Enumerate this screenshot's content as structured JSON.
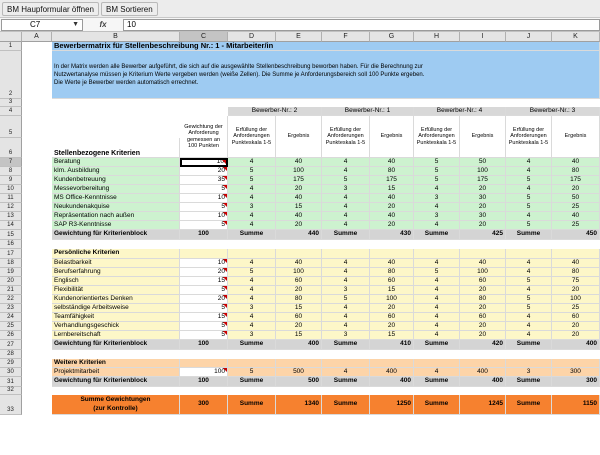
{
  "toolbar": {
    "buttons": [
      "BM Haupformular öffnen",
      "BM Sortieren"
    ]
  },
  "formula_bar": {
    "name_box": "C7",
    "fx_label": "fx",
    "value": "10"
  },
  "columns": [
    "A",
    "B",
    "C",
    "D",
    "E",
    "F",
    "G",
    "H",
    "I",
    "J",
    "K"
  ],
  "selected_cell": "C7",
  "title": "Bewerbermatrix für Stellenbeschreibung Nr.: 1 - Mitarbeiter/in",
  "intro": [
    "In der Matrix werden alle Bewerber aufgeführt, die sich auf die ausgewählte Stellenbeschreibung beworben haben. Für die Berechnung zur",
    "Nutzwertanalyse müssen je Kriterium Werte vergeben werden (weiße Zellen). Die Summe je Anforderungsbereich soll 100 Punkte ergeben.",
    "Die Werte je Bewerber werden automatisch errechnet."
  ],
  "headers": {
    "bewerber": [
      "Bewerber-Nr.: 2",
      "Bewerber-Nr.: 1",
      "Bewerber-Nr.: 4",
      "Bewerber-Nr.: 3"
    ],
    "gewichtung": "Gewichtung der Anforderung gemessen an 100 Punkten",
    "erfuellung": "Erfüllung der Anforderungen Punkteskala 1-5",
    "ergebnis": "Ergebnis",
    "section1": "Stellenbezogene Kriterien"
  },
  "section1": {
    "rows": [
      {
        "label": "Beratung",
        "w": "10",
        "v": [
          "4",
          "40",
          "4",
          "40",
          "5",
          "50",
          "4",
          "40"
        ]
      },
      {
        "label": "klm. Ausbildung",
        "w": "20",
        "v": [
          "5",
          "100",
          "4",
          "80",
          "5",
          "100",
          "4",
          "80"
        ]
      },
      {
        "label": "Kundenbetreuung",
        "w": "35",
        "v": [
          "5",
          "175",
          "5",
          "175",
          "5",
          "175",
          "5",
          "175"
        ]
      },
      {
        "label": "Messevorbereitung",
        "w": "5",
        "v": [
          "4",
          "20",
          "3",
          "15",
          "4",
          "20",
          "4",
          "20"
        ]
      },
      {
        "label": "MS Office-Kenntnisse",
        "w": "10",
        "v": [
          "4",
          "40",
          "4",
          "40",
          "3",
          "30",
          "5",
          "50"
        ]
      },
      {
        "label": "Neukundenakquise",
        "w": "5",
        "v": [
          "3",
          "15",
          "4",
          "20",
          "4",
          "20",
          "5",
          "25"
        ]
      },
      {
        "label": "Repräsentation nach außen",
        "w": "10",
        "v": [
          "4",
          "40",
          "4",
          "40",
          "3",
          "30",
          "4",
          "40"
        ]
      },
      {
        "label": "SAP R3-Kenntnisse",
        "w": "5",
        "v": [
          "4",
          "20",
          "4",
          "20",
          "4",
          "20",
          "5",
          "25"
        ]
      }
    ],
    "total": {
      "label": "Gewichtung für Kriterienblock",
      "w": "100",
      "sum_label": "Summe",
      "sums": [
        "440",
        "430",
        "425",
        "450"
      ]
    }
  },
  "section2": {
    "title": "Persönliche Kriterien",
    "rows": [
      {
        "label": "Belastbarkeit",
        "w": "10",
        "v": [
          "4",
          "40",
          "4",
          "40",
          "4",
          "40",
          "4",
          "40"
        ]
      },
      {
        "label": "Berufserfahrung",
        "w": "20",
        "v": [
          "5",
          "100",
          "4",
          "80",
          "5",
          "100",
          "4",
          "80"
        ]
      },
      {
        "label": "Englisch",
        "w": "15",
        "v": [
          "4",
          "60",
          "4",
          "60",
          "4",
          "60",
          "5",
          "75"
        ]
      },
      {
        "label": "Flexibilität",
        "w": "5",
        "v": [
          "4",
          "20",
          "3",
          "15",
          "4",
          "20",
          "4",
          "20"
        ]
      },
      {
        "label": "Kundenorientiertes Denken",
        "w": "20",
        "v": [
          "4",
          "80",
          "5",
          "100",
          "4",
          "80",
          "5",
          "100"
        ]
      },
      {
        "label": "selbständige Arbeitsweise",
        "w": "5",
        "v": [
          "3",
          "15",
          "4",
          "20",
          "4",
          "20",
          "5",
          "25"
        ]
      },
      {
        "label": "Teamfähigkeit",
        "w": "15",
        "v": [
          "4",
          "60",
          "4",
          "60",
          "4",
          "60",
          "4",
          "60"
        ]
      },
      {
        "label": "Verhandlungsgeschick",
        "w": "5",
        "v": [
          "4",
          "20",
          "4",
          "20",
          "4",
          "20",
          "4",
          "20"
        ]
      },
      {
        "label": "Lernbereitschaft",
        "w": "5",
        "v": [
          "3",
          "15",
          "3",
          "15",
          "4",
          "20",
          "4",
          "20"
        ]
      }
    ],
    "total": {
      "label": "Gewichtung für Kriterienblock",
      "w": "100",
      "sum_label": "Summe",
      "sums": [
        "400",
        "410",
        "420",
        "400"
      ]
    }
  },
  "section3": {
    "title": "Weitere Kriterien",
    "rows": [
      {
        "label": "Projektmitarbeit",
        "w": "100",
        "v": [
          "5",
          "500",
          "4",
          "400",
          "4",
          "400",
          "3",
          "300"
        ]
      }
    ],
    "total": {
      "label": "Gewichtung für Kriterienblock",
      "w": "100",
      "sum_label": "Summe",
      "sums": [
        "500",
        "400",
        "400",
        "300"
      ]
    }
  },
  "grand_total": {
    "label_line1": "Summe Gewichtungen",
    "label_line2": "(zur Kontrolle)",
    "w": "300",
    "sum_label": "Summe",
    "sums": [
      "1340",
      "1250",
      "1245",
      "1150"
    ]
  },
  "colors": {
    "title_blue": "#9ecbf2",
    "green": "#cdf2cf",
    "yellow": "#fdf7c8",
    "peach": "#fdd4a8",
    "orange": "#f6812f",
    "header_grey": "#d8d8d8",
    "total_grey": "#d4d4d4",
    "red_marker": "#cc0000"
  }
}
